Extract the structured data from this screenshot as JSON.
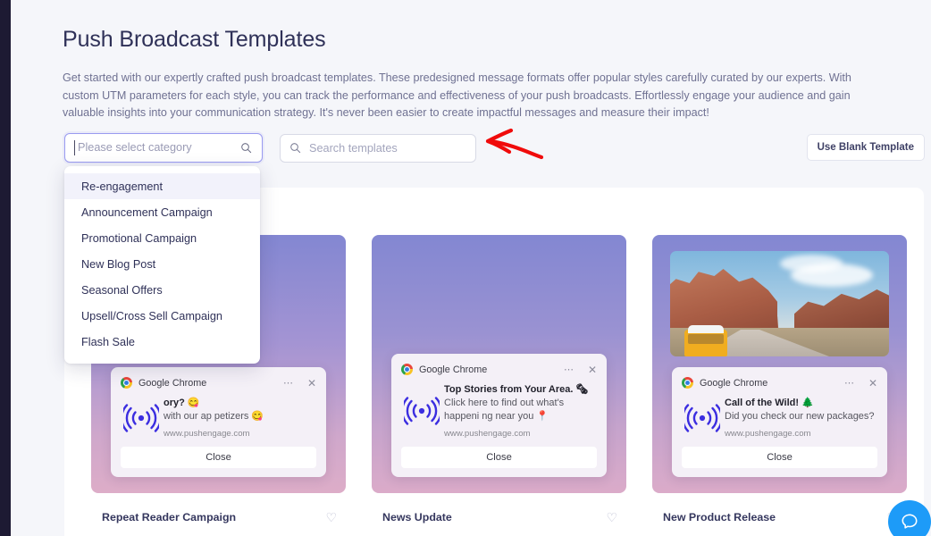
{
  "page": {
    "title": "Push Broadcast Templates",
    "description": "Get started with our expertly crafted push broadcast templates. These predesigned message formats offer popular styles carefully curated by our experts. With custom UTM parameters for each style, you can track the performance and effectiveness of your push broadcasts. Effortlessly engage your audience and gain valuable insights into your communication strategy. It's never been easier to create impactful messages and measure their impact!"
  },
  "toolbar": {
    "category_placeholder": "Please select category",
    "category_value": "",
    "search_placeholder": "Search templates",
    "search_value": "",
    "blank_template_label": "Use Blank Template",
    "search_icon": "search-icon"
  },
  "dropdown": {
    "open": true,
    "selected_index": 0,
    "items": [
      {
        "label": "Re-engagement"
      },
      {
        "label": "Announcement Campaign"
      },
      {
        "label": "Promotional Campaign"
      },
      {
        "label": "New Blog Post"
      },
      {
        "label": "Seasonal Offers"
      },
      {
        "label": "Upsell/Cross Sell Campaign"
      },
      {
        "label": "Flash Sale"
      }
    ]
  },
  "annotation": {
    "arrow_color": "#f00b0b",
    "arrow_direction": "left"
  },
  "cards": [
    {
      "name": "Repeat Reader Campaign",
      "has_photo": false,
      "notification": {
        "app": "Google Chrome",
        "title": "ory? 😋",
        "message": "with our ap petizers 😋",
        "url": "www.pushengage.com",
        "button": "Close",
        "menu_icon": "more-options-icon",
        "close_icon": "close-icon",
        "badge_icon": "push-wifi-icon"
      },
      "favorite_icon": "heart-outline-icon"
    },
    {
      "name": "News Update",
      "has_photo": false,
      "notification": {
        "app": "Google Chrome",
        "title": "Top Stories from Your Area. 🗞",
        "message": "Click here to find out what's happeni ng near you 📍",
        "url": "www.pushengage.com",
        "button": "Close",
        "menu_icon": "more-options-icon",
        "close_icon": "close-icon",
        "badge_icon": "push-wifi-icon"
      },
      "favorite_icon": "heart-outline-icon"
    },
    {
      "name": "New Product Release",
      "has_photo": true,
      "photo_alt": "desert canyon road with yellow van",
      "notification": {
        "app": "Google Chrome",
        "title": "Call of the Wild! 🌲",
        "message": "Did you check our new packages?",
        "url": "www.pushengage.com",
        "button": "Close",
        "menu_icon": "more-options-icon",
        "close_icon": "close-icon",
        "badge_icon": "push-wifi-icon"
      },
      "favorite_icon": "heart-outline-icon"
    }
  ],
  "chat_widget": {
    "icon": "chat-bubble-icon",
    "color": "#1d9bf8"
  }
}
